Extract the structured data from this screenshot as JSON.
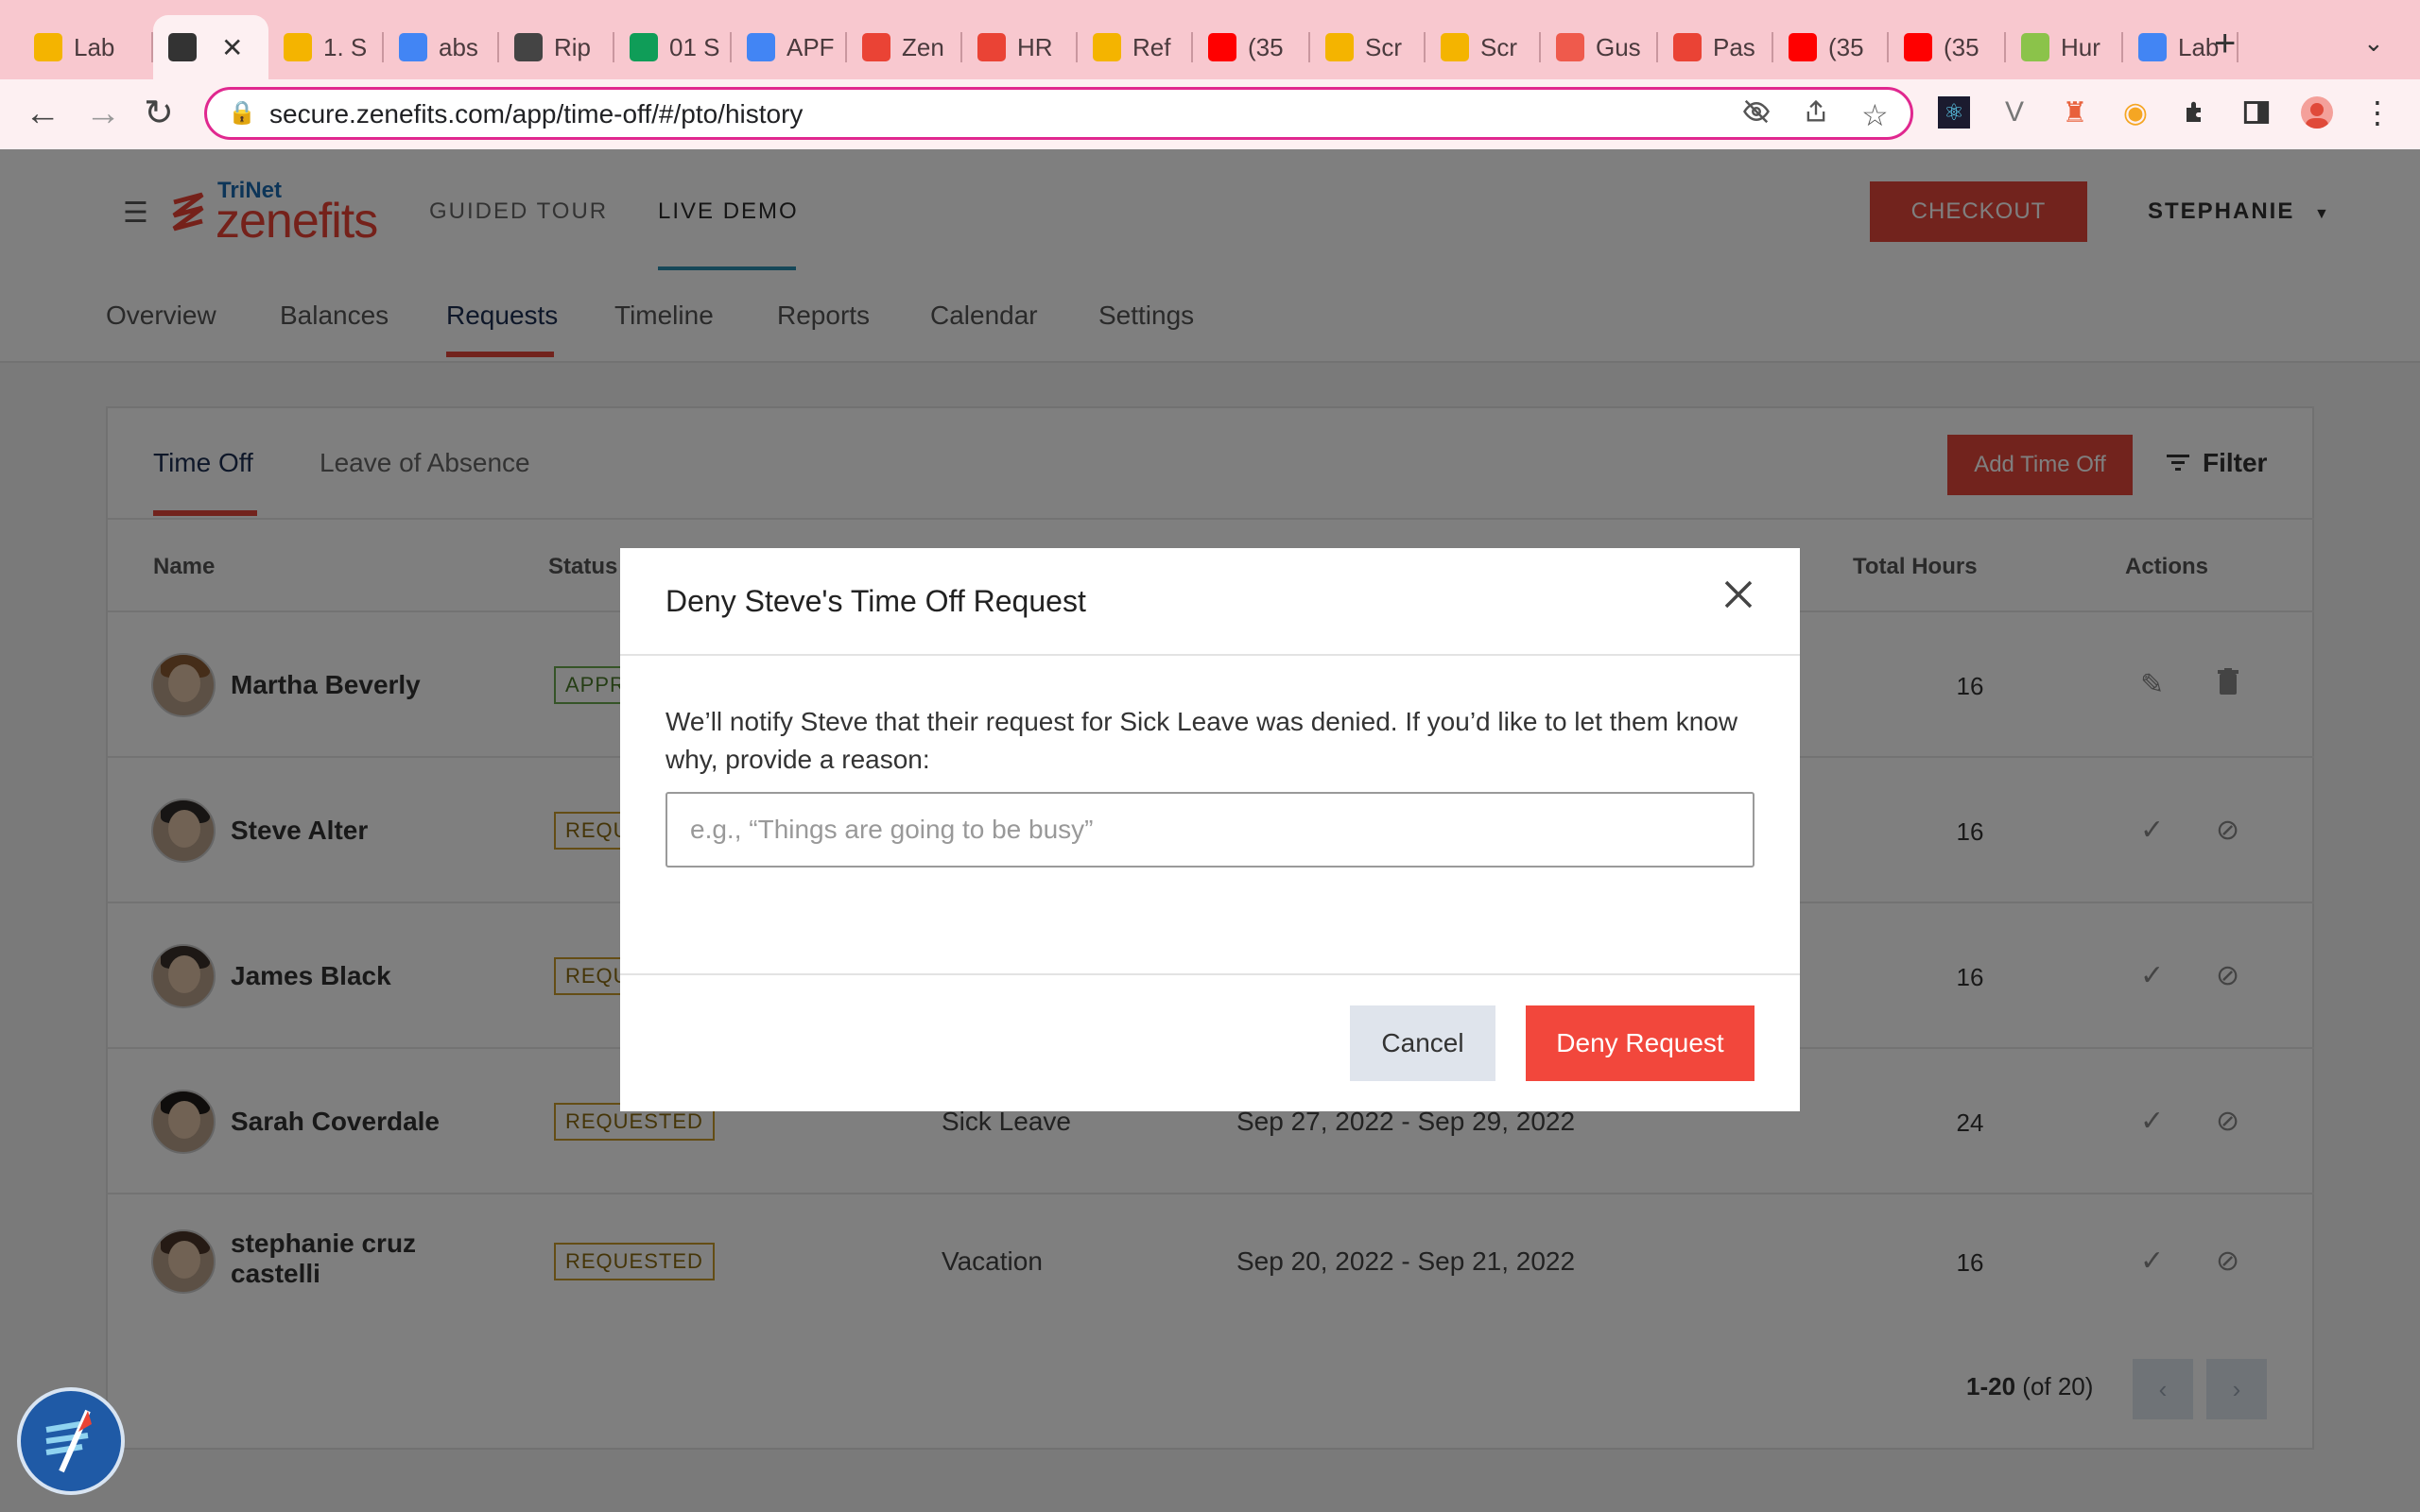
{
  "browser": {
    "tabs": [
      {
        "label": "Lab",
        "icon": "slides-icon",
        "color": "#f4b400"
      },
      {
        "label": "",
        "icon": "globe-icon",
        "color": "#333333",
        "active": true
      },
      {
        "label": "1. S",
        "icon": "slides-icon",
        "color": "#f4b400"
      },
      {
        "label": "abs",
        "icon": "google-icon",
        "color": "#4285f4"
      },
      {
        "label": "Rip",
        "icon": "ripple-icon",
        "color": "#444444"
      },
      {
        "label": "01 S",
        "icon": "drive-icon",
        "color": "#0f9d58"
      },
      {
        "label": "APF",
        "icon": "docs-icon",
        "color": "#4285f4"
      },
      {
        "label": "Zen",
        "icon": "zenefits-icon",
        "color": "#ea4335"
      },
      {
        "label": "HR",
        "icon": "zenefits-icon",
        "color": "#ea4335"
      },
      {
        "label": "Ref",
        "icon": "slides-icon",
        "color": "#f4b400"
      },
      {
        "label": "(35",
        "icon": "youtube-icon",
        "color": "#ff0000"
      },
      {
        "label": "Scr",
        "icon": "slides-icon",
        "color": "#f4b400"
      },
      {
        "label": "Scr",
        "icon": "slides-icon",
        "color": "#f4b400"
      },
      {
        "label": "Gus",
        "icon": "g-icon",
        "color": "#ef5a4c"
      },
      {
        "label": "Pas",
        "icon": "gmail-icon",
        "color": "#ea4335"
      },
      {
        "label": "(35",
        "icon": "youtube-icon",
        "color": "#ff0000"
      },
      {
        "label": "(35",
        "icon": "youtube-icon",
        "color": "#ff0000"
      },
      {
        "label": "Hur",
        "icon": "ta-icon",
        "color": "#8bc34a"
      },
      {
        "label": "Lab",
        "icon": "docs-icon",
        "color": "#4285f4"
      }
    ],
    "url": "secure.zenefits.com/app/time-off/#/pto/history"
  },
  "header": {
    "logo_small": "TriNet",
    "logo_main": "zenefits",
    "nav": [
      "GUIDED TOUR",
      "LIVE DEMO"
    ],
    "checkout": "CHECKOUT",
    "user": "STEPHANIE",
    "subnav": [
      "Overview",
      "Balances",
      "Requests",
      "Timeline",
      "Reports",
      "Calendar",
      "Settings"
    ]
  },
  "card": {
    "tabs": [
      "Time Off",
      "Leave of Absence"
    ],
    "add_button": "Add Time Off",
    "filter": "Filter",
    "columns": {
      "name": "Name",
      "status": "Status",
      "total_hours": "Total Hours",
      "actions": "Actions"
    },
    "rows": [
      {
        "name": "Martha Beverly",
        "status": "APPR",
        "type": "",
        "dates": "",
        "hours": "16"
      },
      {
        "name": "Steve Alter",
        "status": "REQU",
        "type": "",
        "dates": "",
        "hours": "16"
      },
      {
        "name": "James Black",
        "status": "REQU",
        "type": "",
        "dates": "",
        "hours": "16"
      },
      {
        "name": "Sarah Coverdale",
        "status": "REQUESTED",
        "type": "Sick Leave",
        "dates": "Sep 27, 2022 - Sep 29, 2022",
        "hours": "24"
      },
      {
        "name": "stephanie cruz castelli",
        "status": "REQUESTED",
        "type": "Vacation",
        "dates": "Sep 20, 2022 - Sep 21, 2022",
        "hours": "16"
      }
    ],
    "pager_range": "1-20",
    "pager_total": "(of 20)"
  },
  "modal": {
    "title": "Deny Steve's Time Off Request",
    "message": "We’ll notify Steve that their request for Sick Leave was denied. If you’d like to let them know why, provide a reason:",
    "input_placeholder": "e.g., “Things are going to be busy”",
    "input_value": "",
    "cancel": "Cancel",
    "deny": "Deny Request"
  }
}
